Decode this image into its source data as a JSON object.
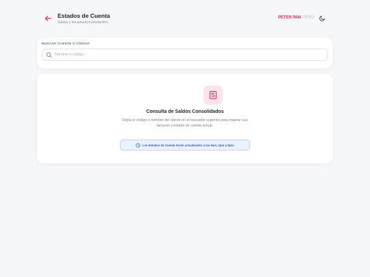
{
  "header": {
    "title": "Estados de Cuenta",
    "subtitle": "Saldos y documentos pendientes",
    "brand_name": "PETER PAN",
    "brand_separator": "|",
    "brand_country": "PERÚ",
    "back_icon": "arrow-left-icon",
    "theme_icon": "moon-icon"
  },
  "search": {
    "label": "BUSCAR CLIENTE O CÓDIGO",
    "placeholder": "Nombre o código...",
    "value": "",
    "icon": "search-icon"
  },
  "result": {
    "icon": "dollar-document-icon",
    "title": "Consulta de Saldos Consolidados",
    "description": "Digita el código o nombre del cliente en el buscador superior para mapear sus facturas y estado de cuenta actual.",
    "info_icon": "clock-icon",
    "info_text": "Los Estados de Cuenta Serán actualizados a las 9am, 2pm y 5pm."
  },
  "colors": {
    "accent": "#e0245e",
    "info_bg": "#eaf2fd",
    "info_text": "#2d5fb5"
  }
}
